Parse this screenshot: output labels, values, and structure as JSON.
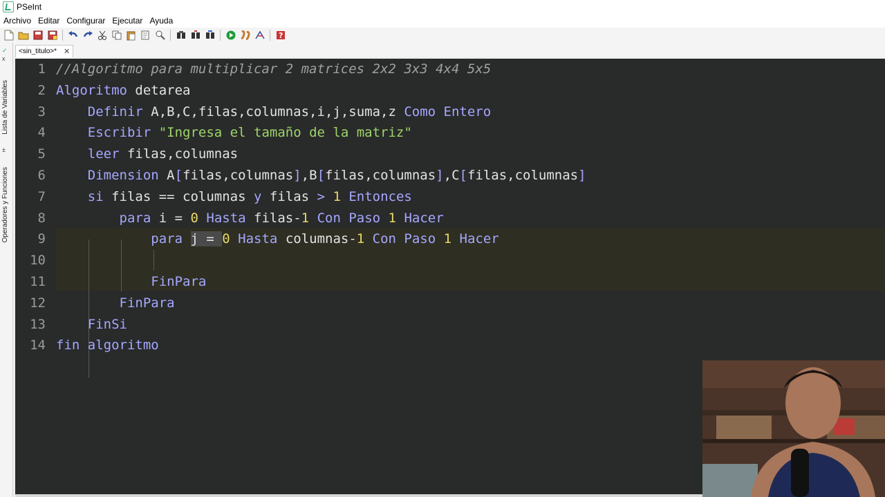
{
  "window": {
    "title": "PSeInt"
  },
  "menu": [
    "Archivo",
    "Editar",
    "Configurar",
    "Ejecutar",
    "Ayuda"
  ],
  "toolbar": {
    "icons": [
      "new-file-icon",
      "open-folder-icon",
      "save-icon",
      "save-as-icon",
      "undo-icon",
      "redo-icon",
      "cut-icon",
      "copy-icon",
      "paste-icon",
      "edit-icon",
      "find-icon",
      "find-next-icon",
      "replace-icon",
      "run-icon",
      "step-icon",
      "debug-icon",
      "help-icon"
    ]
  },
  "side_panel": {
    "variables_label": "Lista de Variables",
    "operators_label": "Operadores y Funciones"
  },
  "tab": {
    "label": "<sin_titulo>*",
    "close": "✕"
  },
  "editor": {
    "line_numbers": [
      "1",
      "2",
      "3",
      "4",
      "5",
      "6",
      "7",
      "8",
      "9",
      "10",
      "11",
      "12",
      "13",
      "14"
    ],
    "lines": [
      [
        [
          "cm",
          "//Algoritmo para multiplicar 2 matrices 2x2 3x3 4x4 5x5"
        ]
      ],
      [
        [
          "kw",
          "Algoritmo"
        ],
        [
          "tx",
          " detarea"
        ]
      ],
      [
        [
          "tx",
          "    "
        ],
        [
          "kw",
          "Definir"
        ],
        [
          "tx",
          " A,B,C,filas,columnas,i,j,suma,z "
        ],
        [
          "kw",
          "Como Entero"
        ]
      ],
      [
        [
          "tx",
          "    "
        ],
        [
          "kw",
          "Escribir"
        ],
        [
          "tx",
          " "
        ],
        [
          "str",
          "\"Ingresa el tamaño de la matriz\""
        ]
      ],
      [
        [
          "tx",
          "    "
        ],
        [
          "kw",
          "leer"
        ],
        [
          "tx",
          " filas,columnas"
        ]
      ],
      [
        [
          "tx",
          "    "
        ],
        [
          "kw",
          "Dimension"
        ],
        [
          "tx",
          " A"
        ],
        [
          "kw",
          "["
        ],
        [
          "tx",
          "filas,columnas"
        ],
        [
          "kw",
          "]"
        ],
        [
          "tx",
          ",B"
        ],
        [
          "kw",
          "["
        ],
        [
          "tx",
          "filas,columnas"
        ],
        [
          "kw",
          "]"
        ],
        [
          "tx",
          ",C"
        ],
        [
          "kw",
          "["
        ],
        [
          "tx",
          "filas,columnas"
        ],
        [
          "kw",
          "]"
        ]
      ],
      [
        [
          "tx",
          "    "
        ],
        [
          "kw",
          "si"
        ],
        [
          "tx",
          " filas == columnas "
        ],
        [
          "kw",
          "y"
        ],
        [
          "tx",
          " filas "
        ],
        [
          "kw",
          ">"
        ],
        [
          "tx",
          " "
        ],
        [
          "num",
          "1"
        ],
        [
          "tx",
          " "
        ],
        [
          "kw",
          "Entonces"
        ]
      ],
      [
        [
          "tx",
          "        "
        ],
        [
          "kw",
          "para"
        ],
        [
          "tx",
          " i = "
        ],
        [
          "num",
          "0"
        ],
        [
          "tx",
          " "
        ],
        [
          "kw",
          "Hasta"
        ],
        [
          "tx",
          " filas-"
        ],
        [
          "num",
          "1"
        ],
        [
          "tx",
          " "
        ],
        [
          "kw",
          "Con Paso"
        ],
        [
          "tx",
          " "
        ],
        [
          "num",
          "1"
        ],
        [
          "tx",
          " "
        ],
        [
          "kw",
          "Hacer"
        ]
      ],
      [
        [
          "tx",
          "            "
        ],
        [
          "kw",
          "para"
        ],
        [
          "tx",
          " "
        ],
        [
          "sel",
          "j = "
        ],
        [
          "num",
          "0"
        ],
        [
          "tx",
          " "
        ],
        [
          "kw",
          "Hasta"
        ],
        [
          "tx",
          " columnas-"
        ],
        [
          "num",
          "1"
        ],
        [
          "tx",
          " "
        ],
        [
          "kw",
          "Con Paso"
        ],
        [
          "tx",
          " "
        ],
        [
          "num",
          "1"
        ],
        [
          "tx",
          " "
        ],
        [
          "kw",
          "Hacer"
        ]
      ],
      [
        [
          "tx",
          ""
        ]
      ],
      [
        [
          "tx",
          "            "
        ],
        [
          "kw",
          "FinPara"
        ]
      ],
      [
        [
          "tx",
          "        "
        ],
        [
          "kw",
          "FinPara"
        ]
      ],
      [
        [
          "tx",
          "    "
        ],
        [
          "kw",
          "FinSi"
        ]
      ],
      [
        [
          "kw",
          "fin algoritmo"
        ]
      ]
    ]
  },
  "colors": {
    "editor_bg": "#292a2a",
    "keyword": "#a5a8ff",
    "string": "#9ed56a",
    "number": "#ead96b",
    "comment": "#a0a0a0",
    "text": "#e3e3e3"
  }
}
